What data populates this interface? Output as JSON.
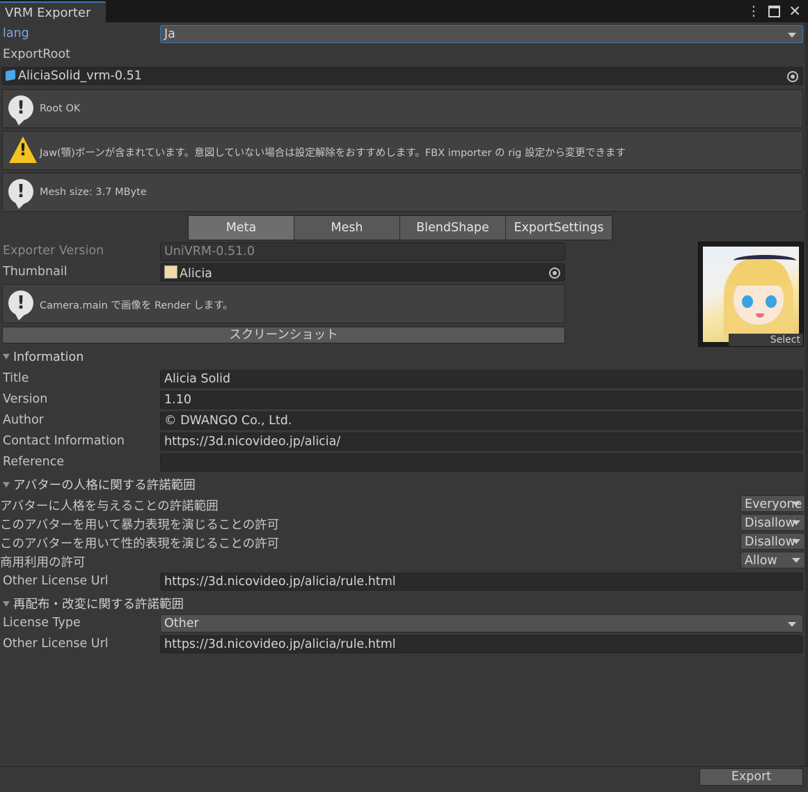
{
  "window": {
    "tab_title": "VRM Exporter",
    "menu_icon": "kebab-menu-icon",
    "maximize_icon": "maximize-icon",
    "close_icon": "close-icon"
  },
  "lang": {
    "label": "lang",
    "value": "Ja"
  },
  "export_root": {
    "label": "ExportRoot",
    "value": "AliciaSolid_vrm-0.51",
    "object_icon": "prefab-cube-icon"
  },
  "messages": [
    {
      "type": "info",
      "text": "Root OK"
    },
    {
      "type": "warning",
      "text": "Jaw(顎)ボーンが含まれています。意図していない場合は設定解除をおすすめします。FBX importer の rig 設定から変更できます"
    },
    {
      "type": "info",
      "text": "Mesh size: 3.7 MByte"
    }
  ],
  "tabs": [
    {
      "label": "Meta",
      "active": true
    },
    {
      "label": "Mesh",
      "active": false
    },
    {
      "label": "BlendShape",
      "active": false
    },
    {
      "label": "ExportSettings",
      "active": false
    }
  ],
  "meta": {
    "exporter_version": {
      "label": "Exporter Version",
      "value": "UniVRM-0.51.0"
    },
    "thumbnail": {
      "label": "Thumbnail",
      "value": "Alicia"
    },
    "camera_message": "Camera.main で画像を Render します。",
    "screenshot_button": "スクリーンショット",
    "thumbnail_select": "Select"
  },
  "information": {
    "section_label": "Information",
    "title": {
      "label": "Title",
      "value": "Alicia Solid"
    },
    "version": {
      "label": "Version",
      "value": "1.10"
    },
    "author": {
      "label": "Author",
      "value": "© DWANGO Co., Ltd."
    },
    "contact": {
      "label": "Contact Information",
      "value": "https://3d.nicovideo.jp/alicia/"
    },
    "reference": {
      "label": "Reference",
      "value": ""
    }
  },
  "personation": {
    "section_label": "アバターの人格に関する許諾範囲",
    "allowed_user": {
      "label": "アバターに人格を与えることの許諾範囲",
      "value": "Everyone"
    },
    "violent": {
      "label": "このアバターを用いて暴力表現を演じることの許可",
      "value": "Disallow"
    },
    "sexual": {
      "label": "このアバターを用いて性的表現を演じることの許可",
      "value": "Disallow"
    },
    "commercial": {
      "label": "商用利用の許可",
      "value": "Allow"
    },
    "other_license_url": {
      "label": "Other License Url",
      "value": "https://3d.nicovideo.jp/alicia/rule.html"
    }
  },
  "redistribution": {
    "section_label": "再配布・改変に関する許諾範囲",
    "license_type": {
      "label": "License Type",
      "value": "Other"
    },
    "other_license_url": {
      "label": "Other License Url",
      "value": "https://3d.nicovideo.jp/alicia/rule.html"
    }
  },
  "footer": {
    "export_button": "Export"
  }
}
